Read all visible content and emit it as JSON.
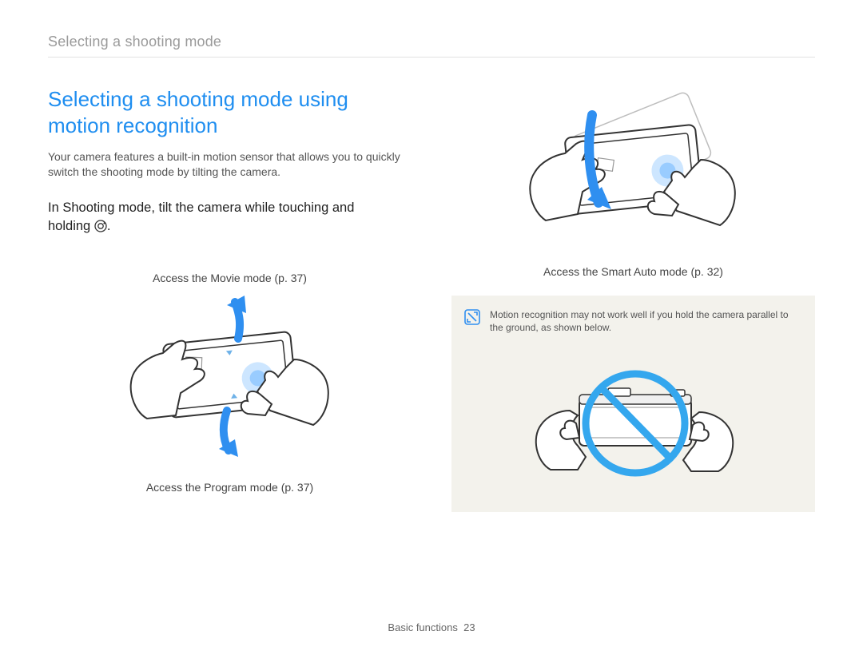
{
  "running_head": "Selecting a shooting mode",
  "section_title": "Selecting a shooting mode using motion recognition",
  "intro": "Your camera features a built-in motion sensor that allows you to quickly switch the shooting mode by tilting the camera.",
  "instruction_pre": "In Shooting mode, tilt the camera while touching and holding ",
  "instruction_post": ".",
  "caption_movie": "Access the Movie mode (p. 37)",
  "caption_program": "Access the Program mode (p. 37)",
  "caption_smart": "Access the Smart Auto mode (p. 32)",
  "note_text": "Motion recognition may not work well if you hold the camera parallel to the ground, as shown below.",
  "footer_label": "Basic functions",
  "footer_page": "23"
}
